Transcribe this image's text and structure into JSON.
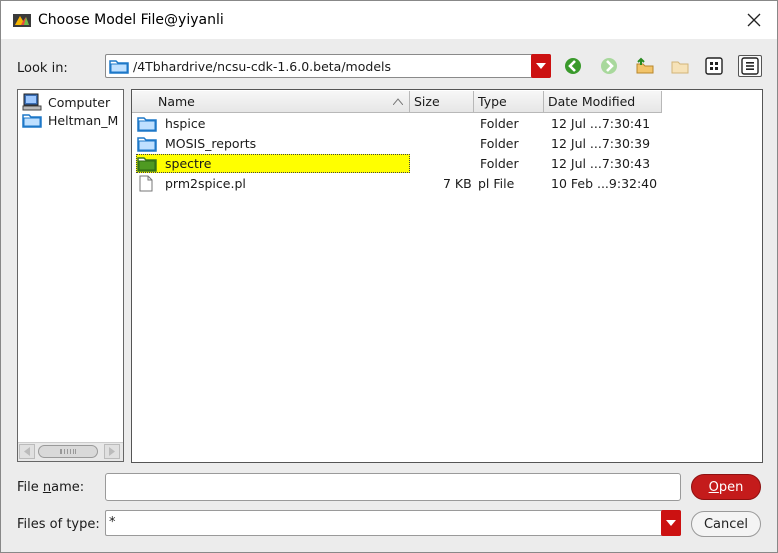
{
  "window": {
    "title": "Choose Model File@yiyanli",
    "close_glyph": "✕"
  },
  "lookin": {
    "label": "Look in:",
    "path": "/4Tbhardrive/ncsu-cdk-1.6.0.beta/models"
  },
  "toolbar": {
    "icons": [
      "back-icon",
      "forward-icon",
      "up-folder-icon",
      "new-folder-icon",
      "list-view-icon",
      "detail-view-icon"
    ]
  },
  "sidebar": {
    "items": [
      {
        "label": "Computer",
        "icon": "computer-icon"
      },
      {
        "label": "Heltman_M",
        "icon": "folder-icon"
      }
    ]
  },
  "filelist": {
    "columns": [
      "Name",
      "Size",
      "Type",
      "Date Modified"
    ],
    "rows": [
      {
        "name": "hspice",
        "size": "",
        "type": "Folder",
        "date": "12 Jul ...7:30:41",
        "icon": "folder-icon"
      },
      {
        "name": "MOSIS_reports",
        "size": "",
        "type": "Folder",
        "date": "12 Jul ...7:30:39",
        "icon": "folder-icon"
      },
      {
        "name": "spectre",
        "size": "",
        "type": "Folder",
        "date": "12 Jul ...7:30:43",
        "icon": "folder-open-icon",
        "selected": true
      },
      {
        "name": "prm2spice.pl",
        "size": "7 KB",
        "type": "pl File",
        "date": "10 Feb ...9:32:40",
        "icon": "file-icon"
      }
    ]
  },
  "footer": {
    "filename_label_pre": "File ",
    "filename_label_mnemonic": "n",
    "filename_label_post": "ame:",
    "filename_value": "",
    "filetype_label": "Files of type:",
    "filetype_value": "*",
    "open_mnemonic": "O",
    "open_rest": "pen",
    "cancel_label": "Cancel"
  },
  "colors": {
    "accent": "#cc1111",
    "selection": "#ffff00",
    "folder": "#1e78c8"
  }
}
